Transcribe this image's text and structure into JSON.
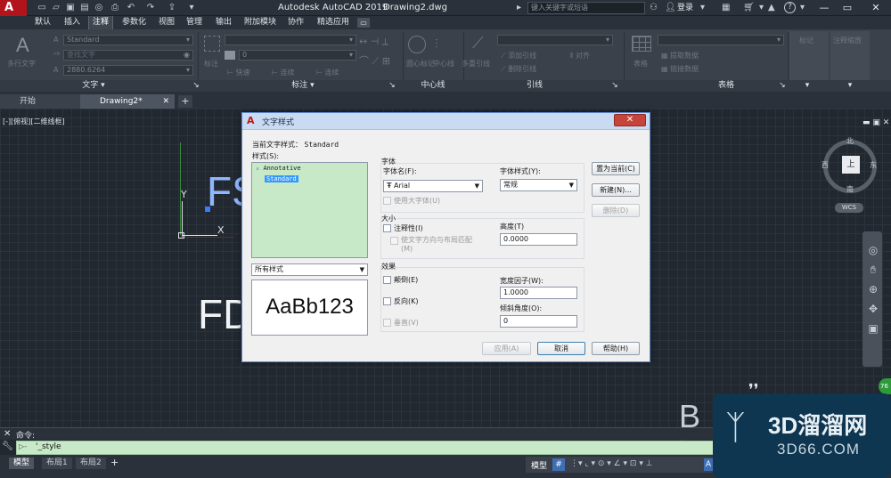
{
  "app": {
    "title": "Autodesk AutoCAD 2019",
    "document": "Drawing2.dwg",
    "logo": "A",
    "search_placeholder": "键入关键字或短语",
    "login": "登录",
    "share_label": "共享"
  },
  "menu_tabs": [
    "默认",
    "插入",
    "注释",
    "参数化",
    "视图",
    "管理",
    "输出",
    "附加模块",
    "协作",
    "精选应用"
  ],
  "active_menu_tab": "注释",
  "ribbon": {
    "text_group": {
      "label": "文字",
      "big_button": "多行文字",
      "style_dropdown": "Standard",
      "find_placeholder": "查找文字",
      "height_value": "2880.6264"
    },
    "dim_group": {
      "label": "标注",
      "big_button": "标注",
      "items": [
        "快速",
        "连续",
        "连续"
      ]
    },
    "centerline_group": {
      "label": "中心线",
      "items": [
        "圆心标记",
        "中心线"
      ]
    },
    "leader_group": {
      "label": "引线",
      "big_button": "多重引线",
      "items": [
        "添加引线",
        "删除引线",
        "对齐"
      ]
    },
    "table_group": {
      "label": "表格",
      "big_button": "表格",
      "items": [
        "提取数据",
        "链接数据"
      ]
    },
    "markup_group": {
      "items": [
        "标记",
        "注释缩放"
      ]
    }
  },
  "file_tabs": [
    {
      "label": "开始",
      "active": false
    },
    {
      "label": "Drawing2*",
      "active": true
    }
  ],
  "viewport_label": "[-][俯视][二维线框]",
  "canvas": {
    "text_top": "FS",
    "text_mid": "FD",
    "wcs": "WCS",
    "compass": {
      "n": "北",
      "s": "南",
      "e": "东",
      "w": "西",
      "top": "上"
    },
    "axis_y": "Y",
    "axis_x": "X"
  },
  "dialog": {
    "title": "文字样式",
    "current_style_label": "当前文字样式：",
    "current_style_value": "Standard",
    "styles_label": "样式(S):",
    "styles": [
      "Annotative",
      "Standard"
    ],
    "selected_style": "Standard",
    "filter_value": "所有样式",
    "preview_text": "AaBb123",
    "font_section": "字体",
    "font_name_label": "字体名(F):",
    "font_name_value": "Arial",
    "font_style_label": "字体样式(Y):",
    "font_style_value": "常规",
    "bigfont_label": "使用大字体(U)",
    "size_section": "大小",
    "annotative_label": "注释性(I)",
    "match_orientation_label": "使文字方向与布局匹配(M)",
    "height_label": "高度(T)",
    "height_value": "0.0000",
    "effects_section": "效果",
    "upside_down_label": "颠倒(E)",
    "backwards_label": "反向(K)",
    "vertical_label": "垂直(V)",
    "width_factor_label": "宽度因子(W):",
    "width_factor_value": "1.0000",
    "oblique_label": "倾斜角度(O):",
    "oblique_value": "0",
    "set_current_btn": "置为当前(C)",
    "new_btn": "新建(N)...",
    "delete_btn": "删除(D)",
    "apply_btn": "应用(A)",
    "cancel_btn": "取消",
    "help_btn": "帮助(H)"
  },
  "command": {
    "history_label": "命令:",
    "input_value": "'_style",
    "input_prompt": "▷-"
  },
  "layout_tabs": [
    "模型",
    "布局1",
    "布局2"
  ],
  "active_layout_tab": "模型",
  "status": {
    "model_label": "模型",
    "badge": "76"
  },
  "watermark": {
    "brand": "3D溜溜网",
    "site": "3D66.COM"
  },
  "colors": {
    "accent_red": "#b3131a",
    "canvas_bg": "#212830",
    "dialog_list_bg": "#c8e9c8",
    "selection": "#3399ff"
  }
}
